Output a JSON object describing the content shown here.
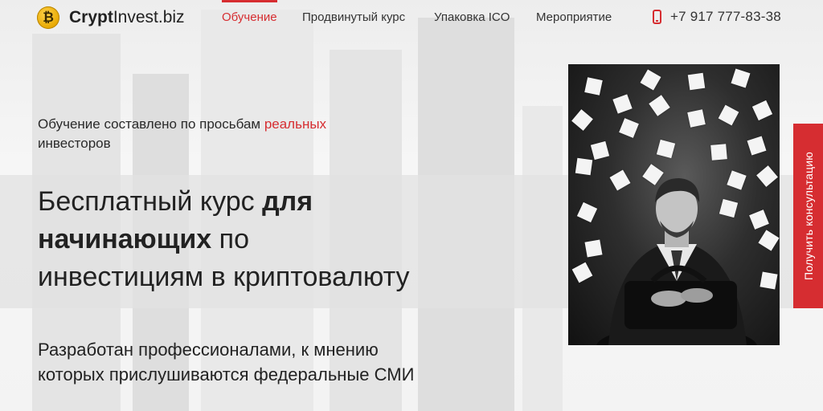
{
  "header": {
    "logo_symbol": "₿",
    "brand_bold": "Crypt",
    "brand_rest": "Invest.biz",
    "nav": [
      {
        "label": "Обучение",
        "active": true
      },
      {
        "label": "Продвинутый курс",
        "active": false
      },
      {
        "label": "Упаковка ICO",
        "active": false
      },
      {
        "label": "Мероприятие",
        "active": false
      }
    ],
    "phone": "+7 917 777-83-38",
    "phone_icon": "mobile-phone-icon"
  },
  "hero": {
    "subtitle_part1": "Обучение составлено по просьбам ",
    "subtitle_accent": "реальных",
    "subtitle_part2": "инвесторов",
    "headline_1": "Бесплатный курс ",
    "headline_1_bold": "для",
    "headline_2_bold": "начинающих",
    "headline_2": " по",
    "headline_3": "инвестициям в криптовалюту",
    "lead_line1": "Разработан профессионалами, к мнению",
    "lead_line2": "которых прислушиваются федеральные СМИ"
  },
  "side_tab": {
    "label": "Получить консультацию"
  },
  "colors": {
    "accent": "#d62d31",
    "text": "#222222",
    "coin": "#e8a800"
  }
}
